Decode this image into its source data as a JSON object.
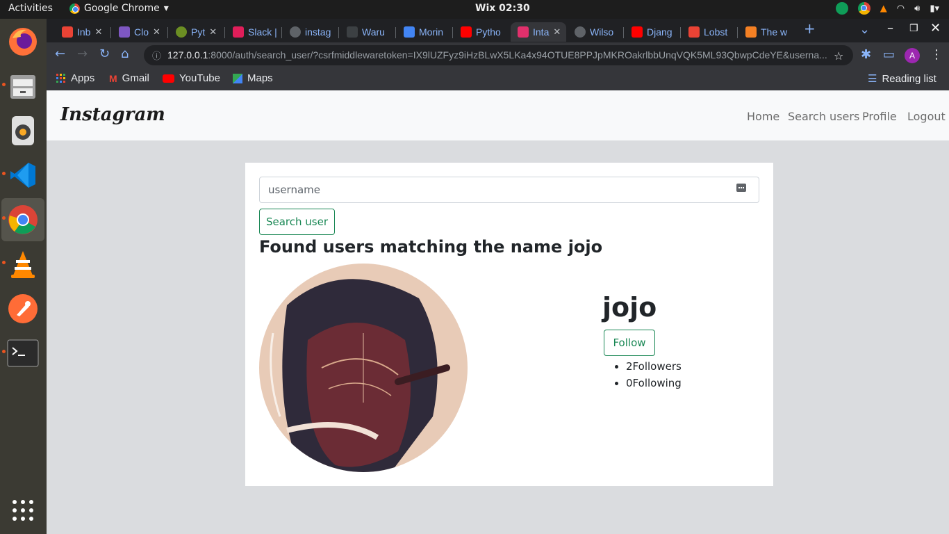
{
  "desktop": {
    "activities": "Activities",
    "app_name": "Google Chrome",
    "clock": "Wix 02:30"
  },
  "browser": {
    "tabs": [
      {
        "label": "Inb",
        "color": "#ea4335"
      },
      {
        "label": "Clo",
        "color": "#7e57c2"
      },
      {
        "label": "Pyt",
        "color": "#6b8e23"
      },
      {
        "label": "Slack |",
        "color": "#e01e5a"
      },
      {
        "label": "instag",
        "color": "#5f6368"
      },
      {
        "label": "Waru",
        "color": "#3c4043"
      },
      {
        "label": "Morin",
        "color": "#4285f4"
      },
      {
        "label": "Pytho",
        "color": "#ff0000"
      },
      {
        "label": "Inta",
        "color": "#e1306c"
      },
      {
        "label": "Wilso",
        "color": "#5f6368"
      },
      {
        "label": "Djang",
        "color": "#ff0000"
      },
      {
        "label": "Lobst",
        "color": "#ea4335"
      },
      {
        "label": "The w",
        "color": "#f48024"
      }
    ],
    "url_host": "127.0.0.1",
    "url_rest": ":8000/auth/search_user/?csrfmiddlewaretoken=IX9lUZFyz9iHzBLwX5LKa4x94OTUE8PPJpMKROakrlbbUnqVQK5ML93QbwpCdeYE&userna...",
    "bookmarks": [
      "Apps",
      "Gmail",
      "YouTube",
      "Maps"
    ],
    "reading_list": "Reading list",
    "profile_initial": "A"
  },
  "navbar": {
    "brand": "Instagram",
    "links": [
      "Home",
      "Search users",
      "Profile",
      "Logout"
    ]
  },
  "search": {
    "placeholder": "username",
    "button_label": "Search user"
  },
  "results": {
    "heading": "Found users matching the name jojo",
    "user": {
      "username": "jojo",
      "follow_label": "Follow",
      "followers": "2Followers",
      "following": "0Following"
    }
  },
  "colors": {
    "accent": "#198754",
    "navbar_bg": "#f8f9fa",
    "page_bg": "#dadcdf"
  }
}
